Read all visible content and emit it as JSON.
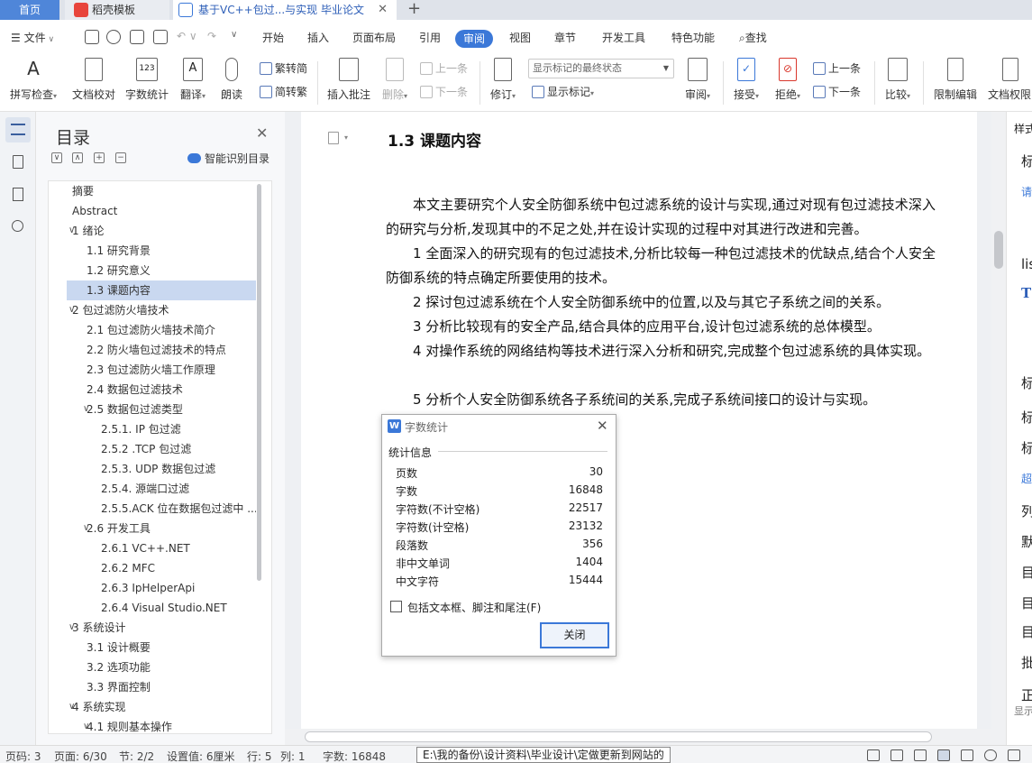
{
  "tabs": {
    "home": "首页",
    "templates": "稻壳模板",
    "document": "基于VC++包过...与实现 毕业论文"
  },
  "menu": {
    "file": "文件",
    "items": [
      "开始",
      "插入",
      "页面布局",
      "引用",
      "审阅",
      "视图",
      "章节",
      "开发工具",
      "特色功能"
    ],
    "search": "查找"
  },
  "ribbon": {
    "spellcheck": "拼写检查",
    "proofread": "文档校对",
    "wordcount": "字数统计",
    "translate": "翻译",
    "readaloud": "朗读",
    "trad_to_simp": "繁转简",
    "simp_to_trad": "简转繁",
    "insert_comment": "插入批注",
    "delete": "删除",
    "prev_comment": "上一条",
    "next_comment": "下一条",
    "revise": "修订",
    "track_state": "显示标记的最终状态",
    "show_markup": "显示标记",
    "review": "审阅",
    "accept": "接受",
    "reject": "拒绝",
    "prev_change": "上一条",
    "next_change": "下一条",
    "compare": "比较",
    "restrict_edit": "限制编辑",
    "doc_permission": "文档权限"
  },
  "nav": {
    "title": "目录",
    "smart_id": "智能识别目录",
    "items": [
      {
        "label": "摘要",
        "level": 0,
        "chevron": ""
      },
      {
        "label": "Abstract",
        "level": 0,
        "chevron": ""
      },
      {
        "label": "1  绪论",
        "level": 0,
        "chevron": "v"
      },
      {
        "label": "1.1  研究背景",
        "level": 1,
        "chevron": ""
      },
      {
        "label": "1.2  研究意义",
        "level": 1,
        "chevron": ""
      },
      {
        "label": "1.3  课题内容",
        "level": 1,
        "chevron": "",
        "selected": true
      },
      {
        "label": "2  包过滤防火墙技术",
        "level": 0,
        "chevron": "v"
      },
      {
        "label": "2.1  包过滤防火墙技术简介",
        "level": 1,
        "chevron": ""
      },
      {
        "label": "2.2  防火墙包过滤技术的特点",
        "level": 1,
        "chevron": ""
      },
      {
        "label": "2.3  包过滤防火墙工作原理",
        "level": 1,
        "chevron": ""
      },
      {
        "label": "2.4  数据包过滤技术",
        "level": 1,
        "chevron": ""
      },
      {
        "label": "2.5  数据包过滤类型",
        "level": 1,
        "chevron": "v"
      },
      {
        "label": "2.5.1. IP 包过滤",
        "level": 2,
        "chevron": ""
      },
      {
        "label": "2.5.2 .TCP 包过滤",
        "level": 2,
        "chevron": ""
      },
      {
        "label": "2.5.3. UDP 数据包过滤",
        "level": 2,
        "chevron": ""
      },
      {
        "label": "2.5.4.  源端口过滤",
        "level": 2,
        "chevron": ""
      },
      {
        "label": "2.5.5.ACK 位在数据包过滤中 ...",
        "level": 2,
        "chevron": ""
      },
      {
        "label": "2.6 开发工具",
        "level": 1,
        "chevron": "v"
      },
      {
        "label": "2.6.1 VC++.NET",
        "level": 2,
        "chevron": ""
      },
      {
        "label": "2.6.2 MFC",
        "level": 2,
        "chevron": ""
      },
      {
        "label": "2.6.3 IpHelperApi",
        "level": 2,
        "chevron": ""
      },
      {
        "label": "2.6.4 Visual Studio.NET",
        "level": 2,
        "chevron": ""
      },
      {
        "label": "3  系统设计",
        "level": 0,
        "chevron": "v"
      },
      {
        "label": "3.1  设计概要",
        "level": 1,
        "chevron": ""
      },
      {
        "label": "3.2  选项功能",
        "level": 1,
        "chevron": ""
      },
      {
        "label": "3.3  界面控制",
        "level": 1,
        "chevron": ""
      },
      {
        "label": "4  系统实现",
        "level": 0,
        "chevron": "v"
      },
      {
        "label": "4.1  规则基本操作",
        "level": 1,
        "chevron": "v"
      }
    ]
  },
  "document": {
    "heading": "1.3  课题内容",
    "paragraphs": [
      "本文主要研究个人安全防御系统中包过滤系统的设计与实现,通过对现有包过滤技术深入的研究与分析,发现其中的不足之处,并在设计实现的过程中对其进行改进和完善。",
      "1 全面深入的研究现有的包过滤技术,分析比较每一种包过滤技术的优缺点,结合个人安全防御系统的特点确定所要使用的技术。",
      "2 探讨包过滤系统在个人安全防御系统中的位置,以及与其它子系统之间的关系。",
      "3 分析比较现有的安全产品,结合具体的应用平台,设计包过滤系统的总体模型。",
      "4 对操作系统的网络结构等技术进行深入分析和研究,完成整个包过滤系统的具体实现。",
      "5 分析个人安全防御系统各子系统间的关系,完成子系统间接口的设计与实现。"
    ]
  },
  "dialog": {
    "title": "字数统计",
    "section": "统计信息",
    "stats": [
      {
        "label": "页数",
        "value": "30"
      },
      {
        "label": "字数",
        "value": "16848"
      },
      {
        "label": "字符数(不计空格)",
        "value": "22517"
      },
      {
        "label": "字符数(计空格)",
        "value": "23132"
      },
      {
        "label": "段落数",
        "value": "356"
      },
      {
        "label": "非中文单词",
        "value": "1404"
      },
      {
        "label": "中文字符",
        "value": "15444"
      }
    ],
    "checkbox_label": "包括文本框、脚注和尾注(F)",
    "close_label": "关闭"
  },
  "right_panel": {
    "label": "样式",
    "glyphs": [
      "标",
      "请",
      "lis",
      "T",
      "标",
      "标",
      "标",
      "超",
      "列",
      "默",
      "目",
      "目",
      "目",
      "批",
      "正",
      "显示"
    ]
  },
  "status": {
    "page_code": "页码: 3",
    "page": "页面: 6/30",
    "section": "节: 2/2",
    "setting": "设置值: 6厘米",
    "row": "行: 5",
    "col": "列: 1",
    "words": "字数: 16848",
    "path_tip": "E:\\我的备份\\设计资料\\毕业设计\\定做更新到网站的"
  }
}
